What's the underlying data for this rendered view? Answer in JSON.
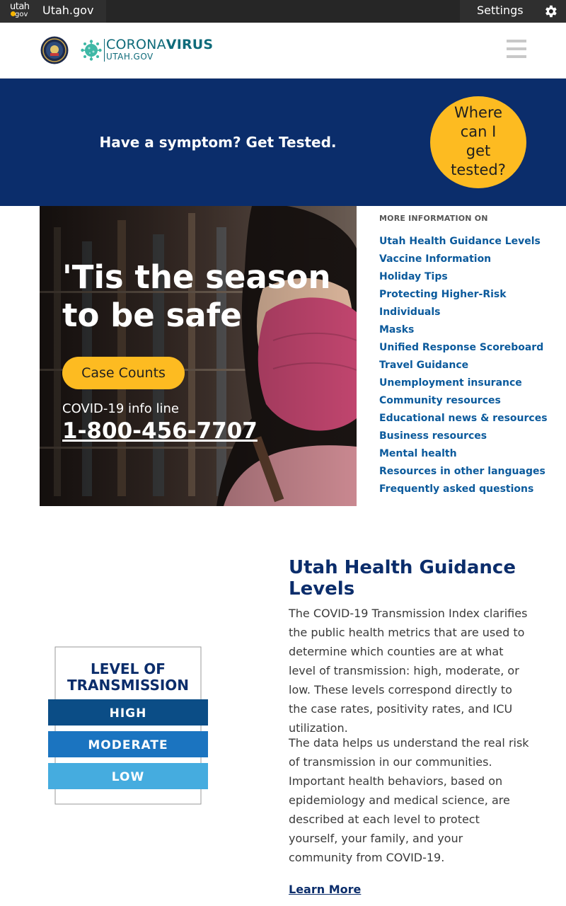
{
  "topbar": {
    "logo_line1": "utah",
    "logo_line2": "gov",
    "site_link": "Utah.gov",
    "settings_label": "Settings"
  },
  "header": {
    "brand_primary_light": "CORONA",
    "brand_primary_bold": "VIRUS",
    "brand_secondary": "UTAH.GOV"
  },
  "banner": {
    "text": "Have a symptom? Get Tested.",
    "test_button_lines": [
      "Where",
      "can I",
      "get",
      "tested?"
    ]
  },
  "hero": {
    "title_line1": "'Tis the season",
    "title_line2": "to be safe",
    "case_button": "Case Counts",
    "info_label": "COVID-19 info line",
    "info_phone": "1-800-456-7707"
  },
  "more_info": {
    "heading": "MORE INFORMATION ON",
    "links": [
      "Utah Health Guidance Levels",
      "Vaccine Information",
      "Holiday Tips",
      "Protecting Higher-Risk",
      "Individuals",
      "Masks",
      "Unified Response Scoreboard",
      "Travel Guidance",
      "Unemployment insurance",
      "Community resources",
      "Educational news & resources",
      "Business resources",
      "Mental health",
      "Resources in other languages",
      "Frequently asked questions"
    ]
  },
  "guidance": {
    "title": "Utah Health Guidance Levels",
    "paragraph1": "The COVID-19 Transmission Index clarifies the public health metrics that are used to determine which counties are at what level of transmission: high, moderate, or low. These levels correspond directly to the case rates, positivity rates, and ICU utilization.",
    "paragraph2": "The data helps us understand the real risk of transmission in our communities. Important health behaviors, based on epidemiology and medical science, are described at each level to protect yourself, your family, and your community from COVID-19.",
    "learn_more": "Learn More",
    "graphic": {
      "title_line1": "LEVEL OF",
      "title_line2": "TRANSMISSION",
      "levels": [
        "HIGH",
        "MODERATE",
        "LOW"
      ]
    }
  },
  "colors": {
    "navy": "#0b2d6b",
    "accent_yellow": "#fdbb21",
    "link_blue": "#0b5a9c",
    "teal": "#0f6b7a"
  }
}
